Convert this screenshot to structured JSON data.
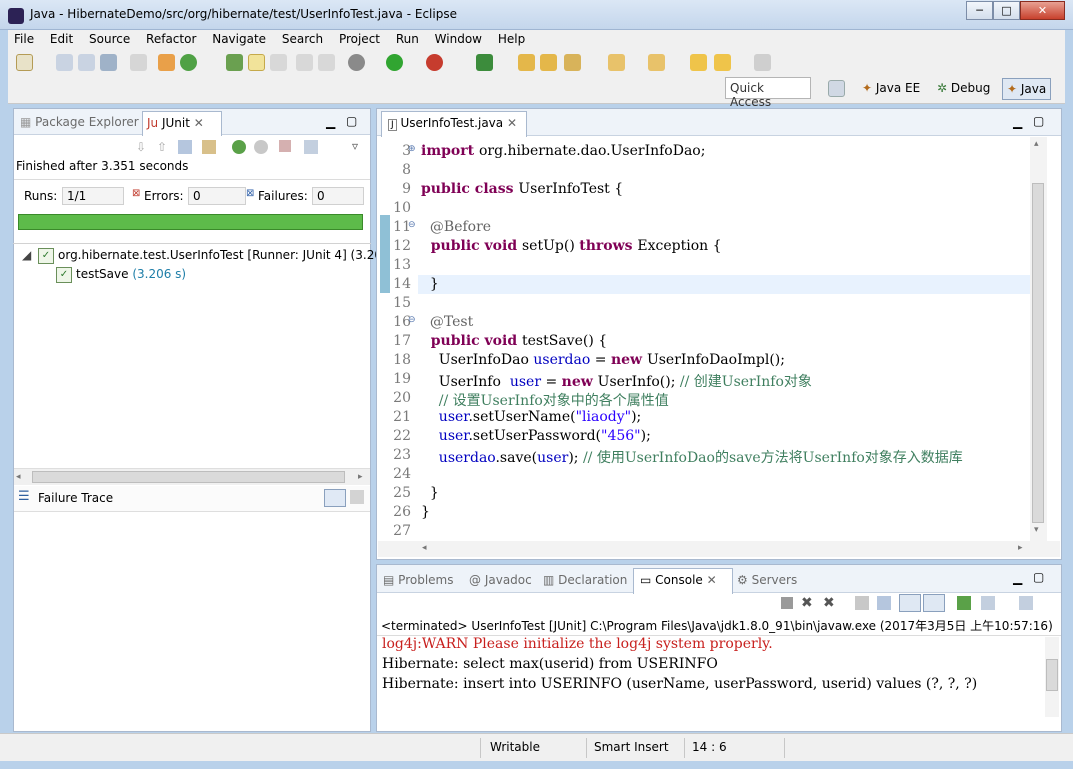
{
  "window": {
    "title": "Java - HibernateDemo/src/org/hibernate/test/UserInfoTest.java - Eclipse",
    "min": "─",
    "max": "□",
    "close": "✕"
  },
  "menu": [
    "File",
    "Edit",
    "Source",
    "Refactor",
    "Navigate",
    "Search",
    "Project",
    "Run",
    "Window",
    "Help"
  ],
  "toolbar": {
    "quick_access": "Quick Access",
    "perspectives": [
      "Java EE",
      "Debug",
      "Java"
    ]
  },
  "left_panel": {
    "tabs": [
      "Package Explorer",
      "JUnit"
    ],
    "status": "Finished after 3.351 seconds",
    "runs_label": "Runs:",
    "runs_value": "1/1",
    "errors_label": "Errors:",
    "errors_value": "0",
    "failures_label": "Failures:",
    "failures_value": "0",
    "tree_root": "org.hibernate.test.UserInfoTest [Runner: JUnit 4] (3.20",
    "tree_child": "testSave",
    "tree_child_time": "(3.206 s)",
    "failure_trace": "Failure Trace"
  },
  "editor": {
    "tab": "UserInfoTest.java",
    "lines": [
      {
        "n": "3",
        "parts": [
          [
            "kw",
            "import "
          ],
          [
            "",
            "org.hibernate.dao.UserInfoDao;"
          ]
        ]
      },
      {
        "n": "8",
        "parts": []
      },
      {
        "n": "9",
        "parts": [
          [
            "kw",
            "public class "
          ],
          [
            "",
            "UserInfoTest {"
          ]
        ]
      },
      {
        "n": "10",
        "parts": []
      },
      {
        "n": "11",
        "parts": [
          [
            "ann",
            "  @Before"
          ]
        ]
      },
      {
        "n": "12",
        "parts": [
          [
            "kw",
            "  public void "
          ],
          [
            "",
            "setUp() "
          ],
          [
            "kw",
            "throws "
          ],
          [
            "",
            "Exception {"
          ]
        ]
      },
      {
        "n": "13",
        "parts": []
      },
      {
        "n": "14",
        "parts": [
          [
            "",
            "  }"
          ]
        ]
      },
      {
        "n": "15",
        "parts": []
      },
      {
        "n": "16",
        "parts": [
          [
            "ann",
            "  @Test"
          ]
        ]
      },
      {
        "n": "17",
        "parts": [
          [
            "kw",
            "  public void "
          ],
          [
            "",
            "testSave() {"
          ]
        ]
      },
      {
        "n": "18",
        "parts": [
          [
            "",
            "    UserInfoDao "
          ],
          [
            "var",
            "userdao"
          ],
          [
            "",
            " = "
          ],
          [
            "kw",
            "new "
          ],
          [
            "",
            "UserInfoDaoImpl();"
          ]
        ]
      },
      {
        "n": "19",
        "parts": [
          [
            "",
            "    UserInfo  "
          ],
          [
            "var",
            "user"
          ],
          [
            "",
            " = "
          ],
          [
            "kw",
            "new "
          ],
          [
            "",
            "UserInfo(); "
          ],
          [
            "com",
            "// 创建UserInfo对象"
          ]
        ]
      },
      {
        "n": "20",
        "parts": [
          [
            "com",
            "    // 设置UserInfo对象中的各个属性值"
          ]
        ]
      },
      {
        "n": "21",
        "parts": [
          [
            "var",
            "    user"
          ],
          [
            "",
            ".setUserName("
          ],
          [
            "str",
            "\"liaody\""
          ],
          [
            "",
            ");"
          ]
        ]
      },
      {
        "n": "22",
        "parts": [
          [
            "var",
            "    user"
          ],
          [
            "",
            ".setUserPassword("
          ],
          [
            "str",
            "\"456\""
          ],
          [
            "",
            ");"
          ]
        ]
      },
      {
        "n": "23",
        "parts": [
          [
            "var",
            "    userdao"
          ],
          [
            "",
            ".save("
          ],
          [
            "var",
            "user"
          ],
          [
            "",
            "); "
          ],
          [
            "com",
            "// 使用UserInfoDao的save方法将UserInfo对象存入数据库"
          ]
        ]
      },
      {
        "n": "24",
        "parts": []
      },
      {
        "n": "25",
        "parts": [
          [
            "",
            "  }"
          ]
        ]
      },
      {
        "n": "26",
        "parts": [
          [
            "",
            "}"
          ]
        ]
      },
      {
        "n": "27",
        "parts": []
      }
    ]
  },
  "console": {
    "tabs": [
      "Problems",
      "Javadoc",
      "Declaration",
      "Console",
      "Servers"
    ],
    "header": "<terminated> UserInfoTest [JUnit] C:\\Program Files\\Java\\jdk1.8.0_91\\bin\\javaw.exe (2017年3月5日 上午10:57:16)",
    "lines": [
      "log4j:WARN Please initialize the log4j system properly.",
      "Hibernate: select max(userid) from USERINFO",
      "Hibernate: insert into USERINFO (userName, userPassword, userid) values (?, ?, ?)"
    ]
  },
  "status": {
    "writable": "Writable",
    "insert": "Smart Insert",
    "position": "14 : 6"
  },
  "colors": {
    "progress": "#5dbb4a",
    "keyword": "#7f0055",
    "error_text": "#c8201e"
  }
}
